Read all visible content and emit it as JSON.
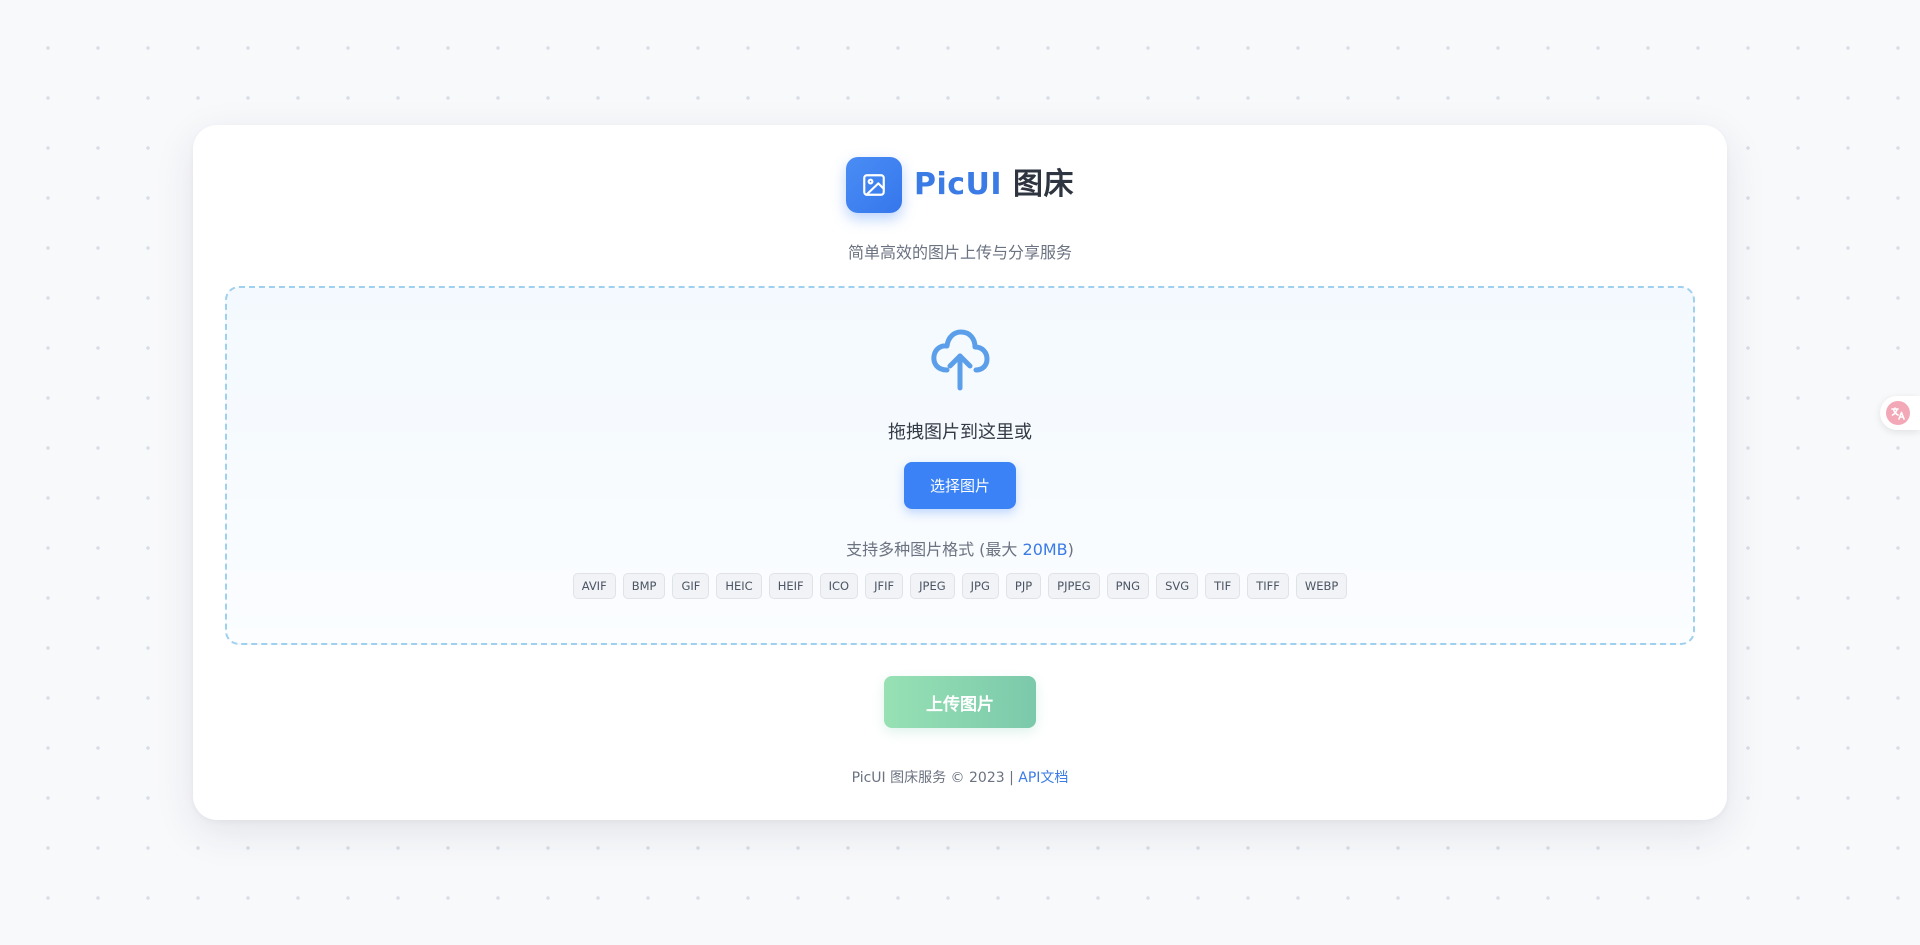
{
  "header": {
    "brand_name": "PicUI",
    "brand_suffix": "图床",
    "subtitle": "简单高效的图片上传与分享服务",
    "logo_icon": "image-icon",
    "accent_color": "#3b82f6"
  },
  "dropzone": {
    "icon": "cloud-upload-icon",
    "prompt": "拖拽图片到这里或",
    "select_button": "选择图片",
    "format_note": "支持多种图片格式 (最大 ",
    "max_size": "20MB",
    "format_note_end": ")",
    "formats": [
      "AVIF",
      "BMP",
      "GIF",
      "HEIC",
      "HEIF",
      "ICO",
      "JFIF",
      "JPEG",
      "JPG",
      "PJP",
      "PJPEG",
      "PNG",
      "SVG",
      "TIF",
      "TIFF",
      "WEBP"
    ]
  },
  "actions": {
    "upload_button": "上传图片",
    "upload_button_state": "disabled"
  },
  "footer": {
    "text": "PicUI 图床服务 © 2023 | ",
    "api_link": "API文档"
  },
  "side": {
    "translate_icon": "translate-icon"
  }
}
